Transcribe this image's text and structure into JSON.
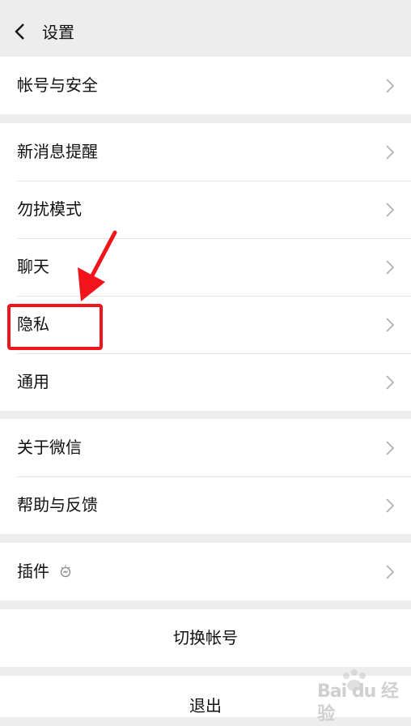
{
  "header": {
    "title": "设置",
    "back_icon": "chevron-left-icon"
  },
  "groups": [
    {
      "items": [
        {
          "label": "帐号与安全"
        }
      ]
    },
    {
      "items": [
        {
          "label": "新消息提醒"
        },
        {
          "label": "勿扰模式"
        },
        {
          "label": "聊天"
        },
        {
          "label": "隐私"
        },
        {
          "label": "通用"
        }
      ]
    },
    {
      "items": [
        {
          "label": "关于微信"
        },
        {
          "label": "帮助与反馈"
        }
      ]
    },
    {
      "items": [
        {
          "label": "插件",
          "icon": "plugin-icon"
        }
      ]
    }
  ],
  "actions": {
    "switch_account": "切换帐号",
    "logout": "退出"
  },
  "annotation": {
    "highlight_color": "#f2141b",
    "highlighted_item": "隐私"
  },
  "watermark": {
    "text": "Bai du 经验"
  }
}
